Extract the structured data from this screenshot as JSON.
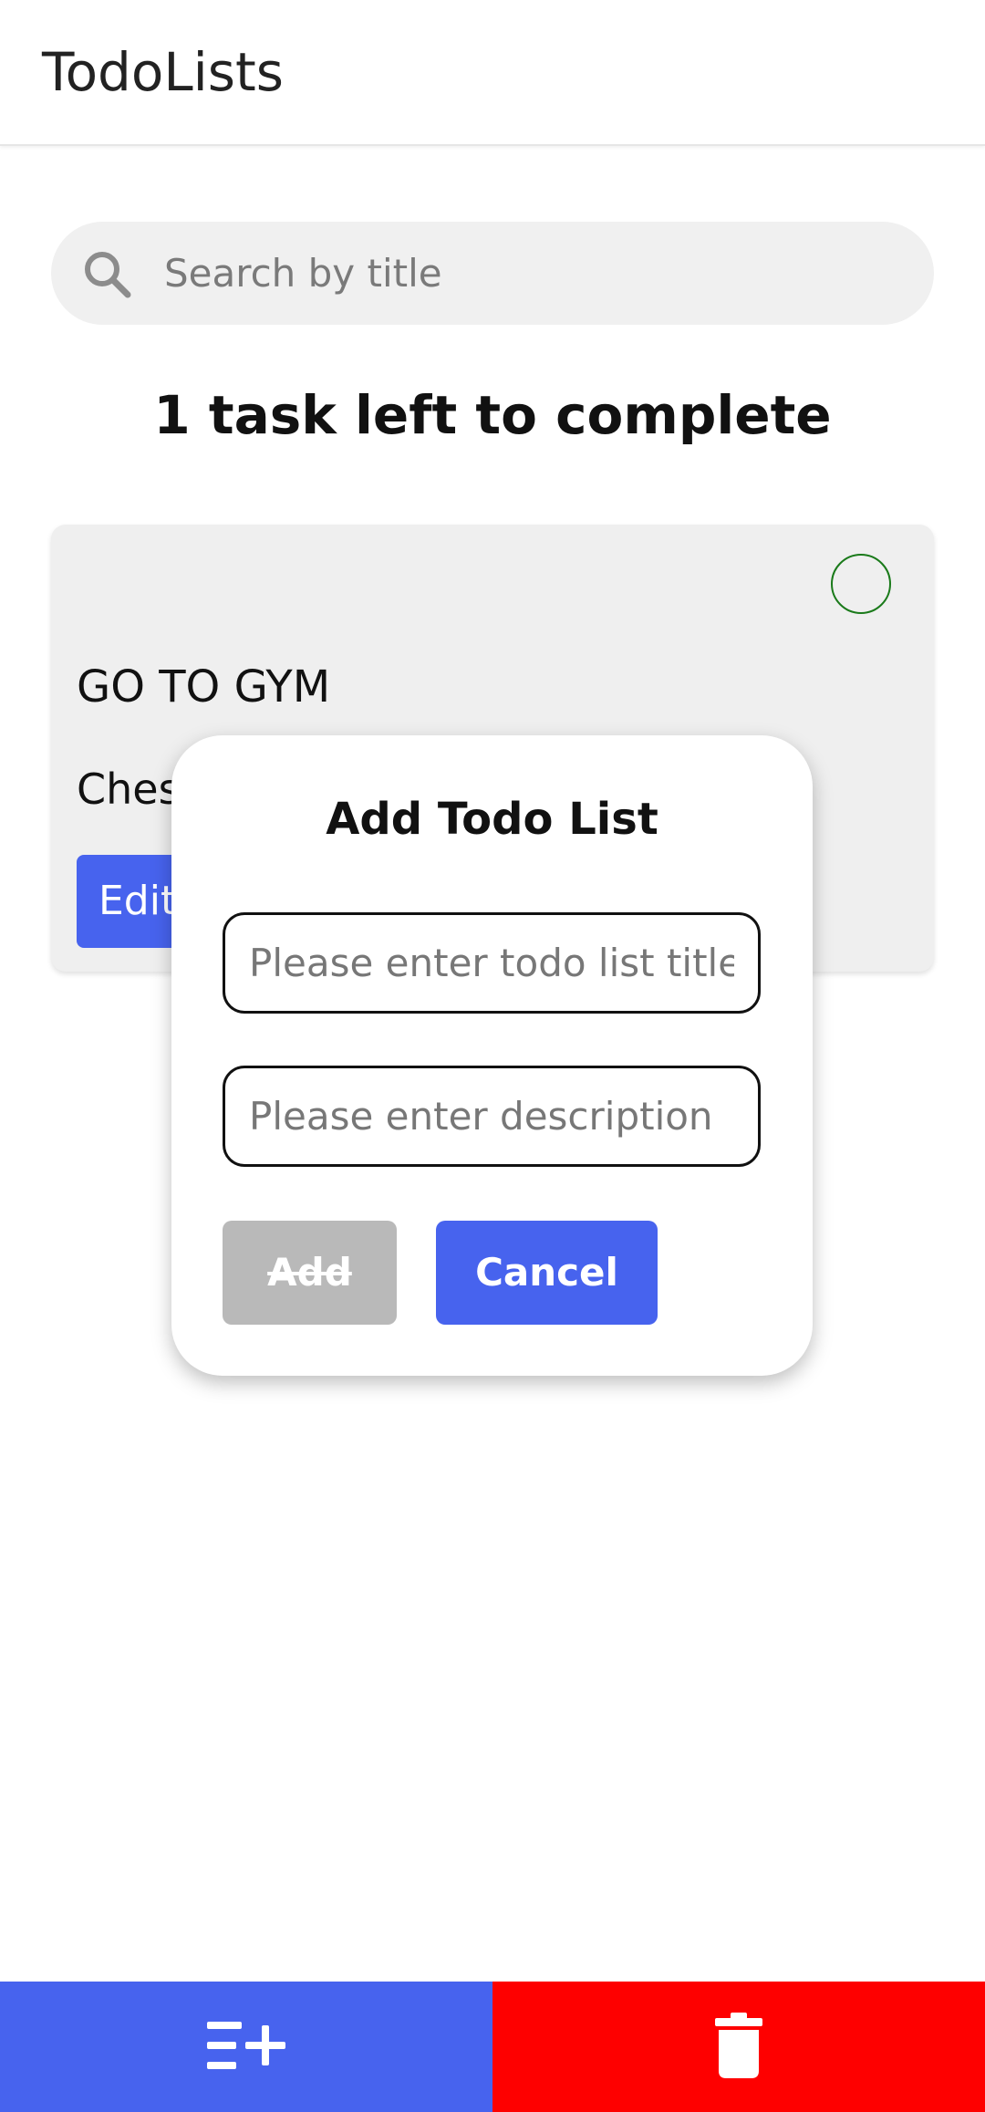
{
  "header": {
    "title": "TodoLists"
  },
  "search": {
    "placeholder": "Search by title",
    "value": ""
  },
  "summary": {
    "tasks_left": "1 task left to complete"
  },
  "todo": {
    "title": "GO TO GYM",
    "description_visible": "Ches",
    "edit_label": "Edit",
    "completed": false
  },
  "dialog": {
    "title": "Add Todo List",
    "title_field_placeholder": "Please enter todo list title",
    "description_field_placeholder": "Please enter description",
    "add_label": "Add",
    "cancel_label": "Cancel",
    "add_enabled": false
  },
  "bottom_bar": {
    "add_icon": "playlist-add-icon",
    "delete_icon": "trash-icon"
  },
  "colors": {
    "primary": "#4763ee",
    "danger": "#fe0000",
    "disabled": "#b9b9b9",
    "card": "#efefef",
    "complete_ring": "#1a7a1a"
  }
}
